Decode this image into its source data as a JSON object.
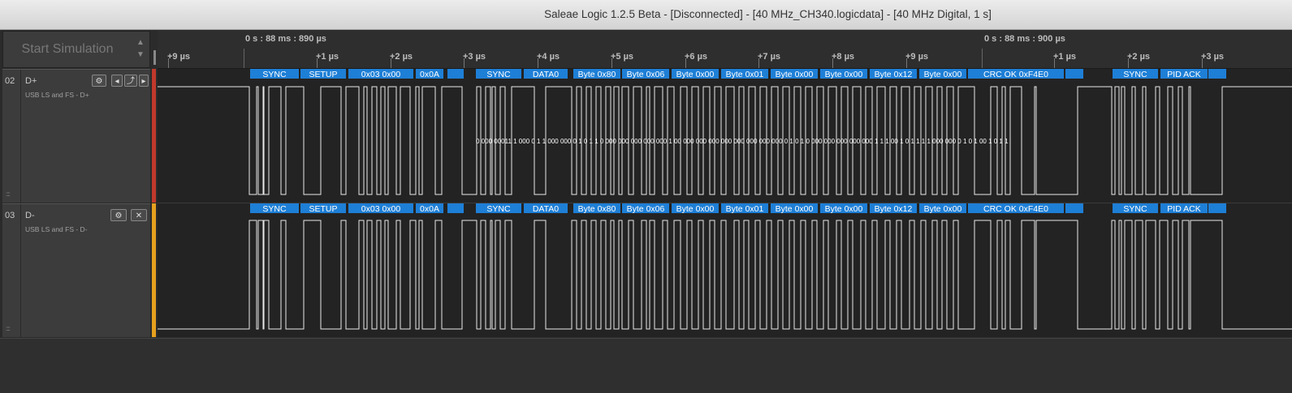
{
  "window": {
    "title": "Saleae Logic 1.2.5 Beta - [Disconnected] - [40 MHz_CH340.logicdata] - [40 MHz Digital, 1 s]"
  },
  "toolbar": {
    "start_simulation": "Start Simulation",
    "spinner_up": "▲",
    "spinner_down": "▼"
  },
  "ruler": {
    "absolute_times": [
      "0 s : 88 ms : 890 µs",
      "0 s : 88 ms : 900 µs"
    ],
    "ticks_a": [
      "+9 µs"
    ],
    "ticks_b": [
      "+1 µs",
      "+2 µs",
      "+3 µs",
      "+4 µs",
      "+5 µs",
      "+6 µs",
      "+7 µs",
      "+8 µs",
      "+9 µs"
    ],
    "ticks_c": [
      "+1 µs",
      "+2 µs",
      "+3 µs"
    ]
  },
  "channels": [
    {
      "number": "02",
      "name": "D+",
      "description": "USB LS and FS - D+",
      "color": "#c0392b"
    },
    {
      "number": "03",
      "name": "D-",
      "description": "USB LS and FS - D-",
      "color": "#e6a01e"
    }
  ],
  "packet_labels": [
    "SYNC",
    "SETUP",
    "0x03 0x00",
    "0x0A",
    "",
    "SYNC",
    "DATA0",
    "Byte 0x80",
    "Byte 0x06",
    "Byte 0x00",
    "Byte 0x01",
    "Byte 0x00",
    "Byte 0x00",
    "Byte 0x12",
    "Byte 0x00",
    "CRC OK 0xF4E0",
    "",
    "SYNC",
    "PID ACK",
    ""
  ],
  "bit_values": "0 000 00011 1 000 0 1 1 000 000 0 1 0 1 1 0 000 000 000 000 000 1 00 000 000 000 000 000 000 000 000 0 1 0 1 0 000 000 000 000 000 1 1 1 00 1 0 1 1 1 1 000 000 0 1 0 1 00 1 0 1 1",
  "colors": {
    "accent": "#1e7fd6",
    "waveform": "#e8e8e8",
    "background": "#232323"
  }
}
